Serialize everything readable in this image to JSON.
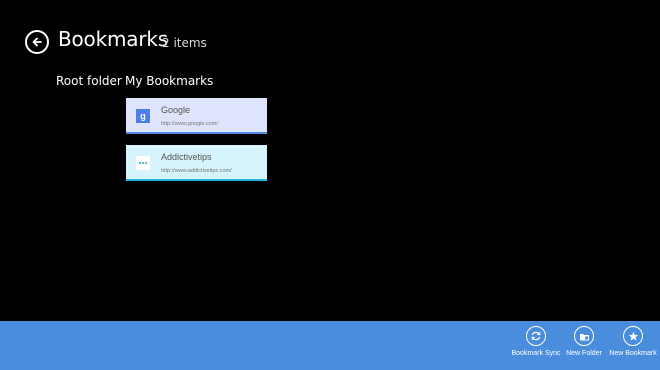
{
  "header": {
    "title": "Bookmarks",
    "item_count": "2 items"
  },
  "breadcrumb": {
    "root": "Root folder",
    "current": "My Bookmarks"
  },
  "bookmarks": [
    {
      "name": "Google",
      "url": "http://www.google.com/",
      "icon": "google-favicon",
      "icon_letter": "g",
      "tile_color": "#dde4fb",
      "accent_color": "#4c86e0"
    },
    {
      "name": "Addictivetips",
      "url": "http://www.addictivetips.com/",
      "icon": "addictivetips-favicon",
      "tile_color": "#d6f4fb",
      "accent_color": "#23b4dc"
    }
  ],
  "app_bar": {
    "background": "#4a8ddc",
    "commands": [
      {
        "label": "Bookmark Sync",
        "icon": "sync-icon"
      },
      {
        "label": "New Folder",
        "icon": "folder-icon"
      },
      {
        "label": "New Bookmark",
        "icon": "star-icon"
      }
    ]
  }
}
